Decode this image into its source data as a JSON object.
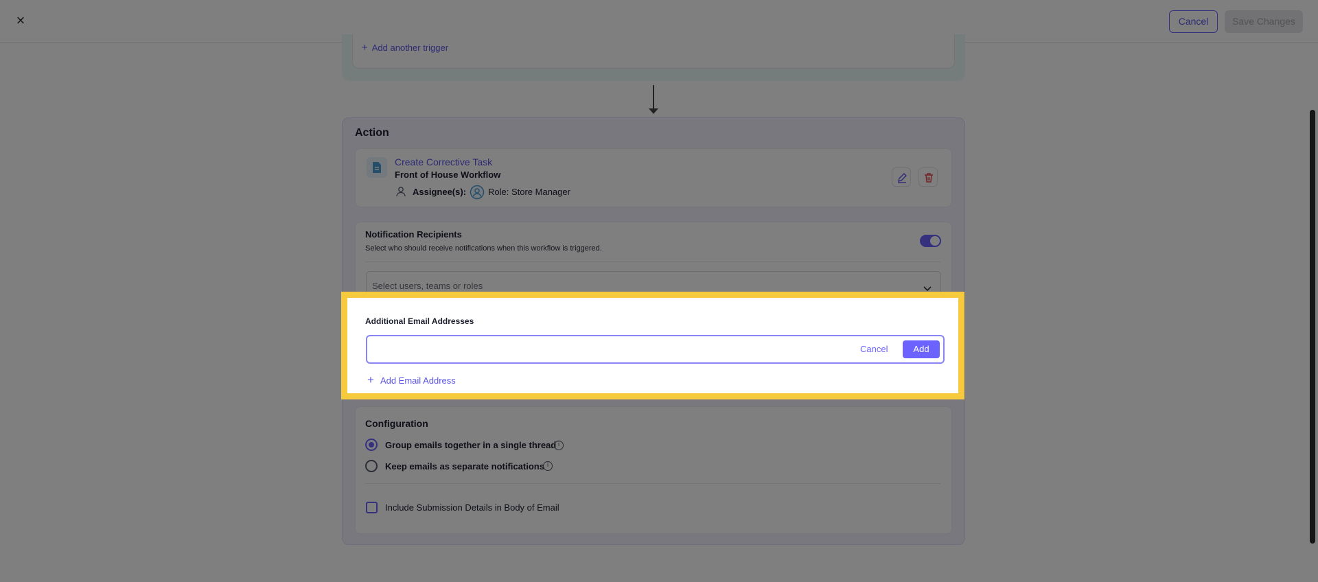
{
  "topbar": {
    "close_glyph": "×",
    "cancel_label": "Cancel",
    "save_label": "Save Changes"
  },
  "trigger": {
    "add_trigger_label": "Add another trigger"
  },
  "action": {
    "title": "Action",
    "task": {
      "link": "Create Corrective Task",
      "subtitle": "Front of House Workflow",
      "assignee_label": "Assignee(s):",
      "role_text": "Role: Store Manager"
    }
  },
  "notifications": {
    "title": "Notification Recipients",
    "description": "Select who should receive notifications when this workflow is triggered.",
    "toggle_on": true,
    "select_placeholder": "Select users, teams or roles"
  },
  "email": {
    "title": "Additional Email Addresses",
    "input_value": "",
    "cancel_label": "Cancel",
    "add_label": "Add",
    "add_email_label": "Add Email Address"
  },
  "configuration": {
    "title": "Configuration",
    "options": [
      {
        "label": "Group emails together in a single thread",
        "checked": true
      },
      {
        "label": "Keep emails as separate notifications",
        "checked": false
      }
    ],
    "include_details_label": "Include Submission Details in Body of Email",
    "include_details_checked": false
  },
  "colors": {
    "accent": "#6c63ff",
    "highlight": "#f7c93d",
    "delete_red": "#e5484d"
  },
  "icons": {
    "close": "close-icon",
    "doc": "document-icon",
    "person": "person-icon",
    "role": "role-icon",
    "edit": "pencil-icon",
    "delete": "trash-icon",
    "chevron": "chevron-down-icon",
    "info": "info-icon",
    "plus": "plus-icon"
  }
}
